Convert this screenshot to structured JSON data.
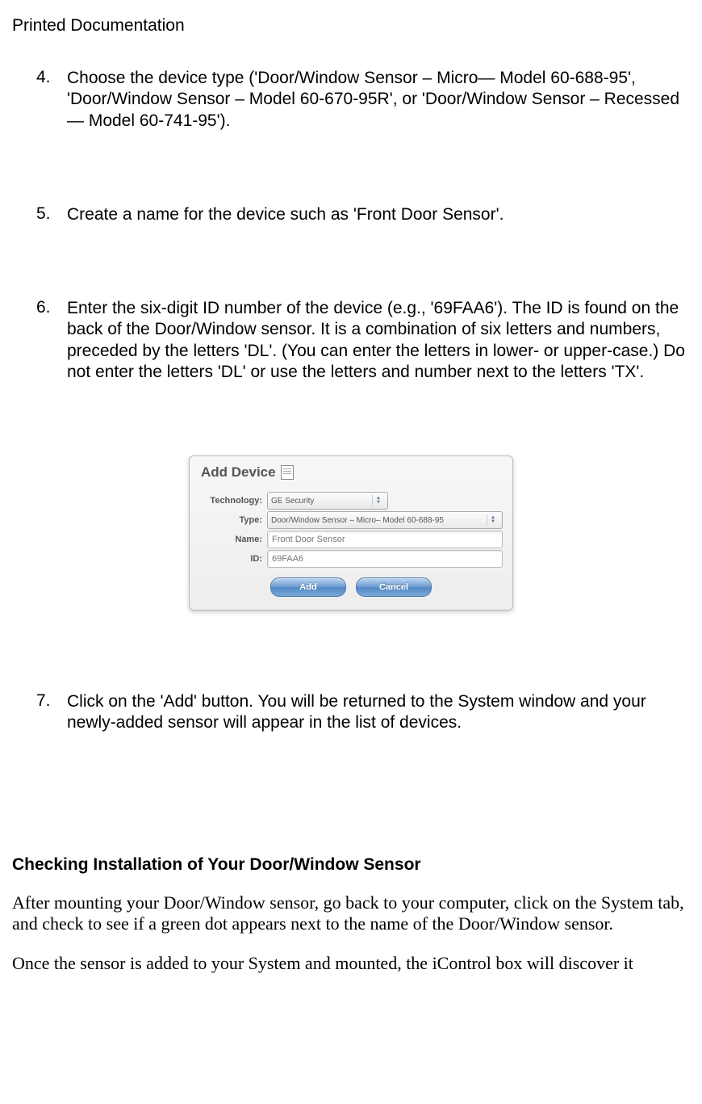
{
  "header": "Printed Documentation",
  "list": {
    "i4": {
      "num": "4.",
      "text": "Choose the device type ('Door/Window Sensor – Micro— Model 60-688-95', 'Door/Window Sensor – Model 60-670-95R', or 'Door/Window Sensor – Recessed— Model 60-741-95')."
    },
    "i5": {
      "num": "5.",
      "text": "Create a name for the device such as 'Front Door Sensor'."
    },
    "i6": {
      "num": "6.",
      "text": "Enter the six-digit ID number of the device (e.g., '69FAA6'). The ID is found on the back of the Door/Window sensor. It is a combination of six letters and numbers, preceded by the letters 'DL'. (You can enter the letters in lower- or upper-case.) Do not enter the letters 'DL' or use the letters and number next to the letters 'TX'."
    },
    "i7": {
      "num": "7.",
      "text": "Click on the 'Add' button. You will be returned to the System window and your newly-added sensor will appear in the list of devices."
    }
  },
  "dialog": {
    "title": "Add Device",
    "fields": {
      "technology": {
        "label": "Technology:",
        "value": "GE Security"
      },
      "type": {
        "label": "Type:",
        "value": "Door/Window Sensor – Micro– Model 60-688-95"
      },
      "name": {
        "label": "Name:",
        "value": "Front Door Sensor"
      },
      "id": {
        "label": "ID:",
        "value": "69FAA6"
      }
    },
    "buttons": {
      "add": "Add",
      "cancel": "Cancel"
    }
  },
  "section": {
    "heading": "Checking Installation of Your Door/Window Sensor",
    "p1": "After mounting your Door/Window sensor, go back to your computer, click on the System tab, and check to see if a green dot appears next to the name of the Door/Window sensor.",
    "p2": "Once the sensor is added to your System and mounted, the iControl box will discover it"
  }
}
